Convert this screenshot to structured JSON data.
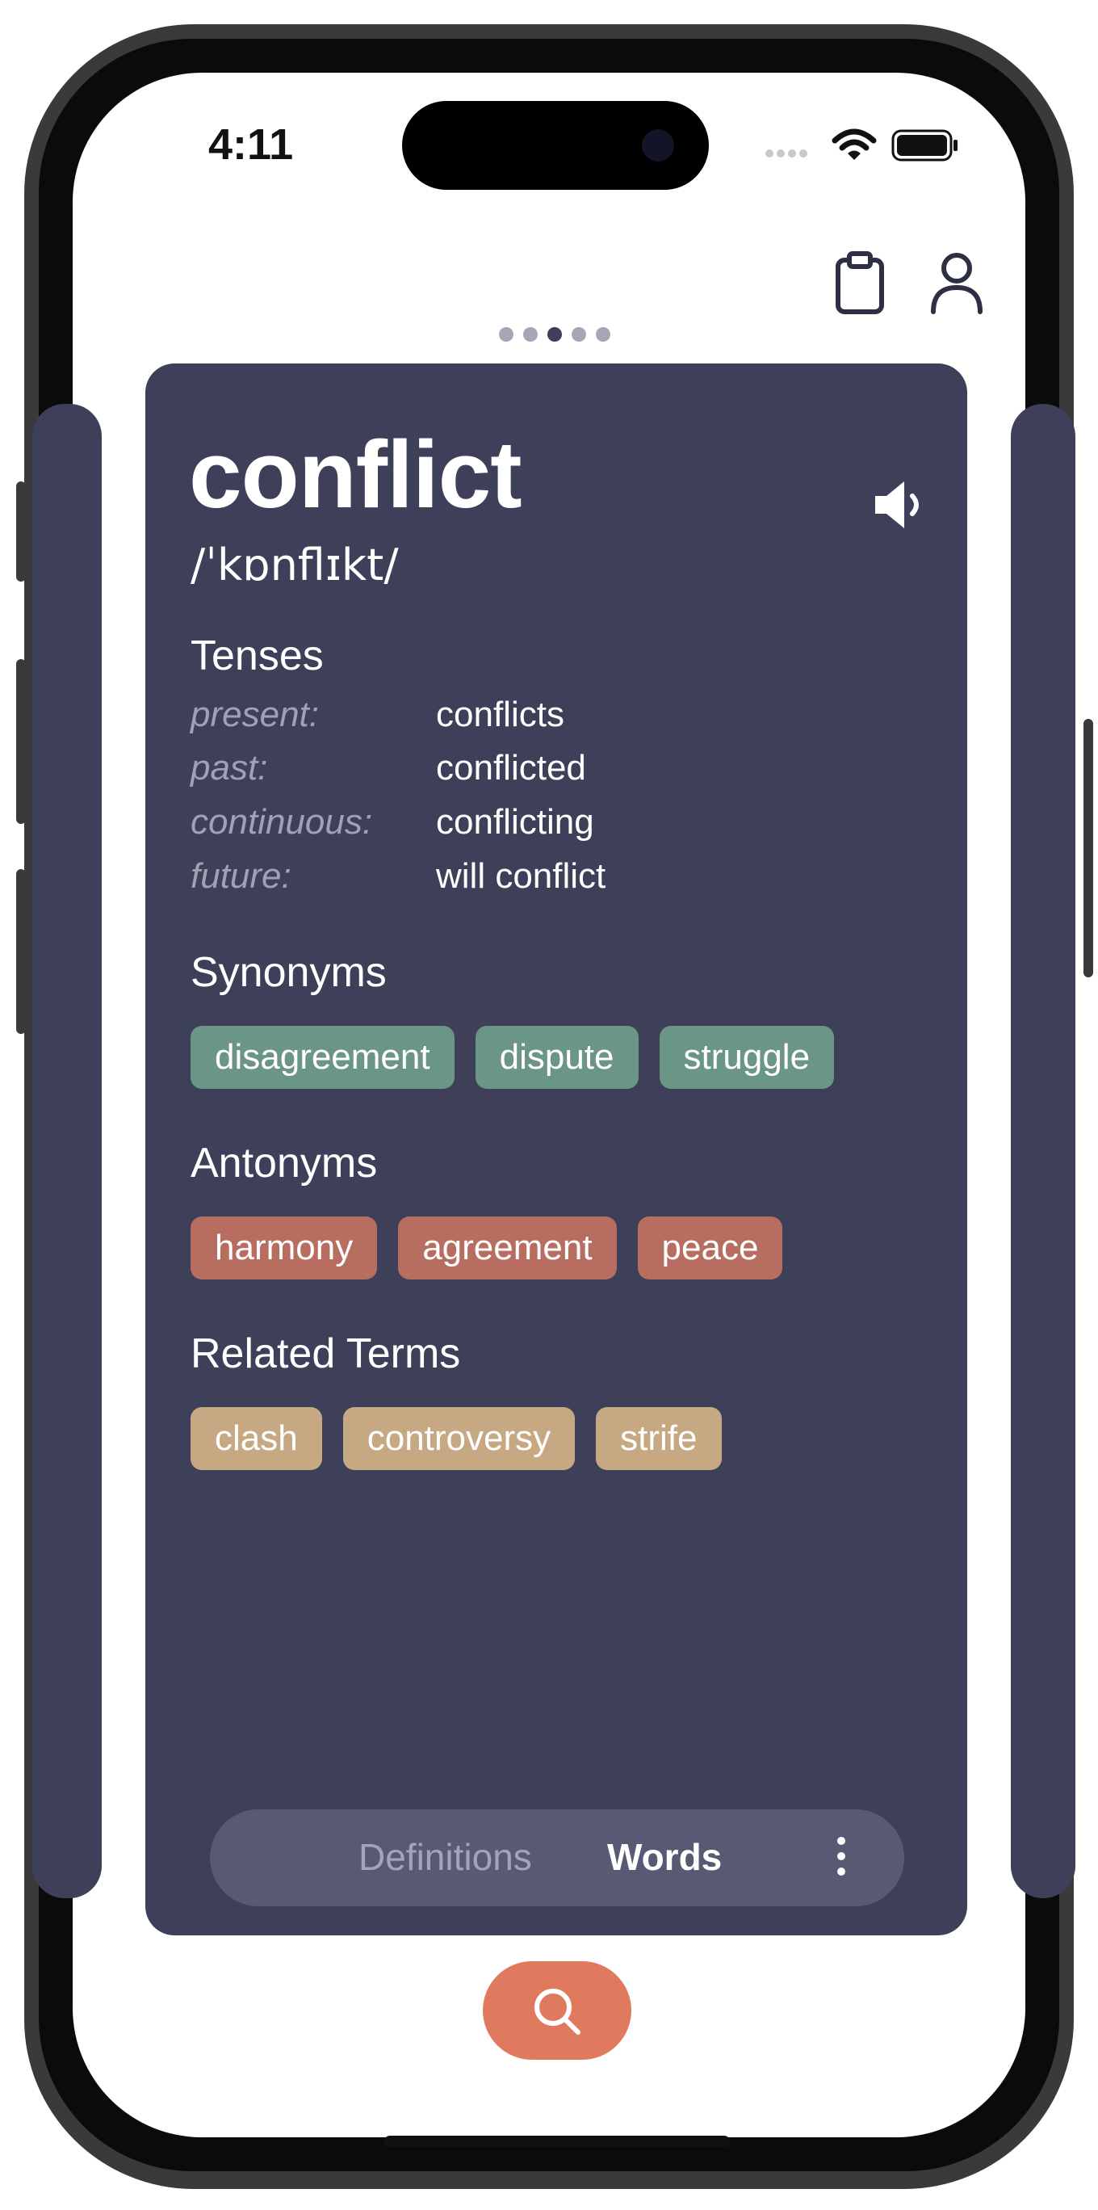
{
  "status_bar": {
    "time": "4:11"
  },
  "pager": {
    "count": 5,
    "active_index": 2
  },
  "entry": {
    "word": "conflict",
    "phonetic": "/ˈkɒnflɪkt/",
    "tenses_title": "Tenses",
    "tenses": [
      {
        "label": "present:",
        "value": "conflicts"
      },
      {
        "label": "past:",
        "value": "conflicted"
      },
      {
        "label": "continuous:",
        "value": "conflicting"
      },
      {
        "label": "future:",
        "value": "will conflict"
      }
    ],
    "synonyms_title": "Synonyms",
    "synonyms": [
      "disagreement",
      "dispute",
      "struggle"
    ],
    "antonyms_title": "Antonyms",
    "antonyms": [
      "harmony",
      "agreement",
      "peace"
    ],
    "related_title": "Related Terms",
    "related": [
      "clash",
      "controversy",
      "strife"
    ]
  },
  "tabs": {
    "definitions": "Definitions",
    "words": "Words",
    "active": "words"
  },
  "icons": {
    "clipboard": "clipboard-icon",
    "profile": "person-icon",
    "speaker": "speaker-icon",
    "more": "more-vertical-icon",
    "search": "search-icon"
  },
  "colors": {
    "card": "#3e4059",
    "synonym_chip": "#6b9585",
    "antonym_chip": "#b86d61",
    "related_chip": "#c6a983",
    "search_button": "#e07a5f"
  }
}
